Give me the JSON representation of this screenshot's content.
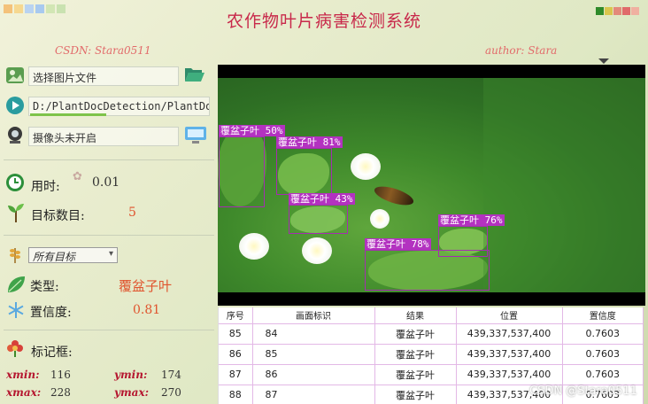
{
  "app": {
    "title": "农作物叶片病害检测系统",
    "csdn": "CSDN: Stara0511",
    "author": "author: Stara"
  },
  "colors": {
    "title": "#c8284a",
    "accent_red": "#e0542e",
    "box": "#a52db0"
  },
  "controls": {
    "select_image_placeholder": "选择图片文件",
    "video_path": "D:/PlantDocDetection/PlantDocDetection",
    "camera_status": "摄像头未开启"
  },
  "stats": {
    "time_label": "用时:",
    "time_value": "0.01",
    "count_label": "目标数目:",
    "count_value": "5",
    "target_select": "所有目标",
    "type_label": "类型:",
    "type_value": "覆盆子叶",
    "confidence_label": "置信度:",
    "confidence_value": "0.81",
    "bbox_label": "标记框:",
    "xmin_label": "xmin:",
    "xmin_value": "116",
    "ymin_label": "ymin:",
    "ymin_value": "174",
    "xmax_label": "xmax:",
    "xmax_value": "228",
    "ymax_label": "ymax:",
    "ymax_value": "270"
  },
  "detections": [
    {
      "label": "覆盆子叶 50%"
    },
    {
      "label": "覆盆子叶 81%"
    },
    {
      "label": "覆盆子叶 43%"
    },
    {
      "label": "覆盆子叶 76%"
    },
    {
      "label": "覆盆子叶 78%"
    }
  ],
  "table": {
    "headers": [
      "序号",
      "画面标识",
      "结果",
      "位置",
      "置信度"
    ],
    "rows": [
      [
        "85",
        "84",
        "覆盆子叶",
        "439,337,537,400",
        "0.7603"
      ],
      [
        "86",
        "85",
        "覆盆子叶",
        "439,337,537,400",
        "0.7603"
      ],
      [
        "87",
        "86",
        "覆盆子叶",
        "439,337,537,400",
        "0.7603"
      ],
      [
        "88",
        "87",
        "覆盆子叶",
        "439,337,537,400",
        "0.7603"
      ]
    ]
  },
  "watermark": "CSDN @Stara0511"
}
